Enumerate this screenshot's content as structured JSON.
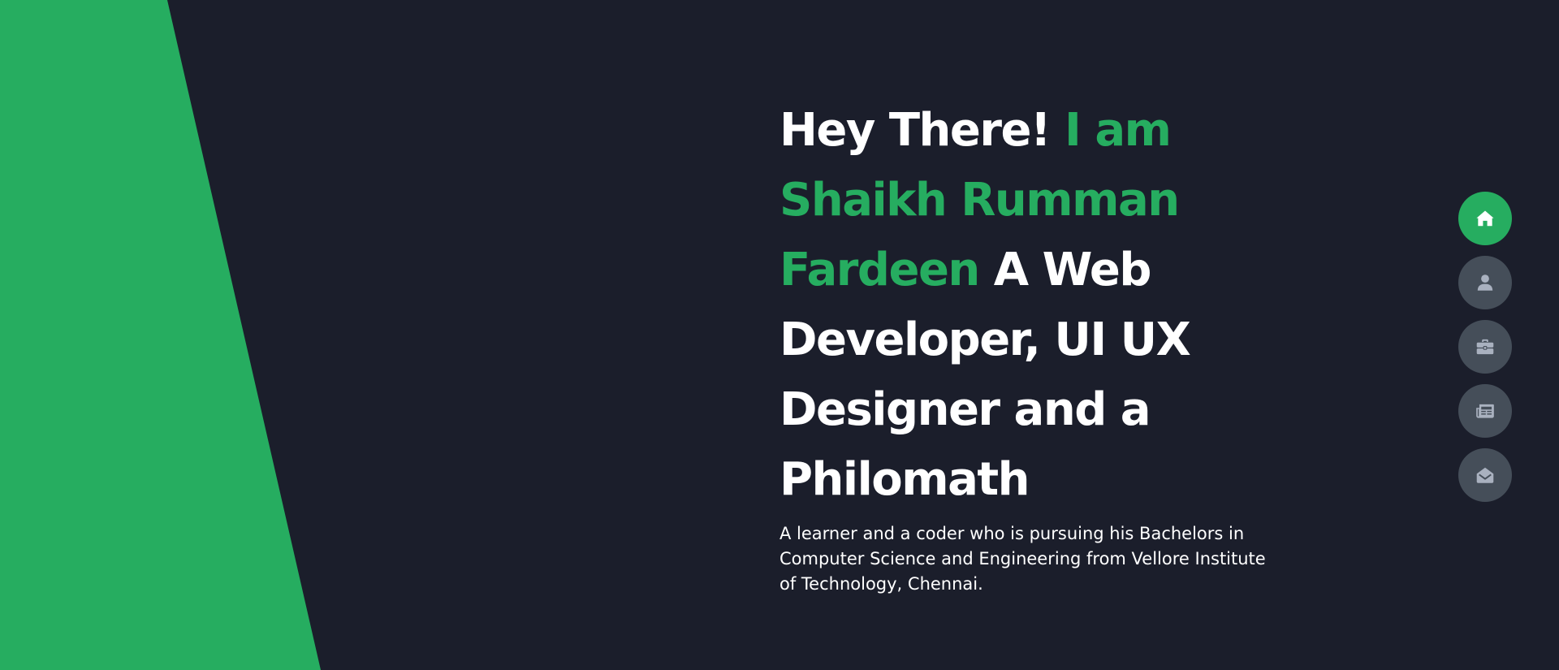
{
  "hero": {
    "greeting": "Hey There!",
    "intro_prefix": " I am",
    "name": " Shaikh Rumman Fardeen",
    "roles": " A Web Developer, UI UX Designer and a Philomath",
    "description": "A learner and a coder who is pursuing his Bachelors in Computer Science and Engineering from Vellore Institute of Technology, Chennai."
  },
  "nav": {
    "items": [
      {
        "icon": "home-icon",
        "active": true
      },
      {
        "icon": "user-icon",
        "active": false
      },
      {
        "icon": "briefcase-icon",
        "active": false
      },
      {
        "icon": "newspaper-icon",
        "active": false
      },
      {
        "icon": "envelope-open-icon",
        "active": false
      }
    ]
  },
  "colors": {
    "background": "#1b1e2b",
    "accent": "#26ad60",
    "nav_inactive": "#454e59",
    "icon_inactive": "#a9b1bf",
    "text": "#ffffff"
  }
}
